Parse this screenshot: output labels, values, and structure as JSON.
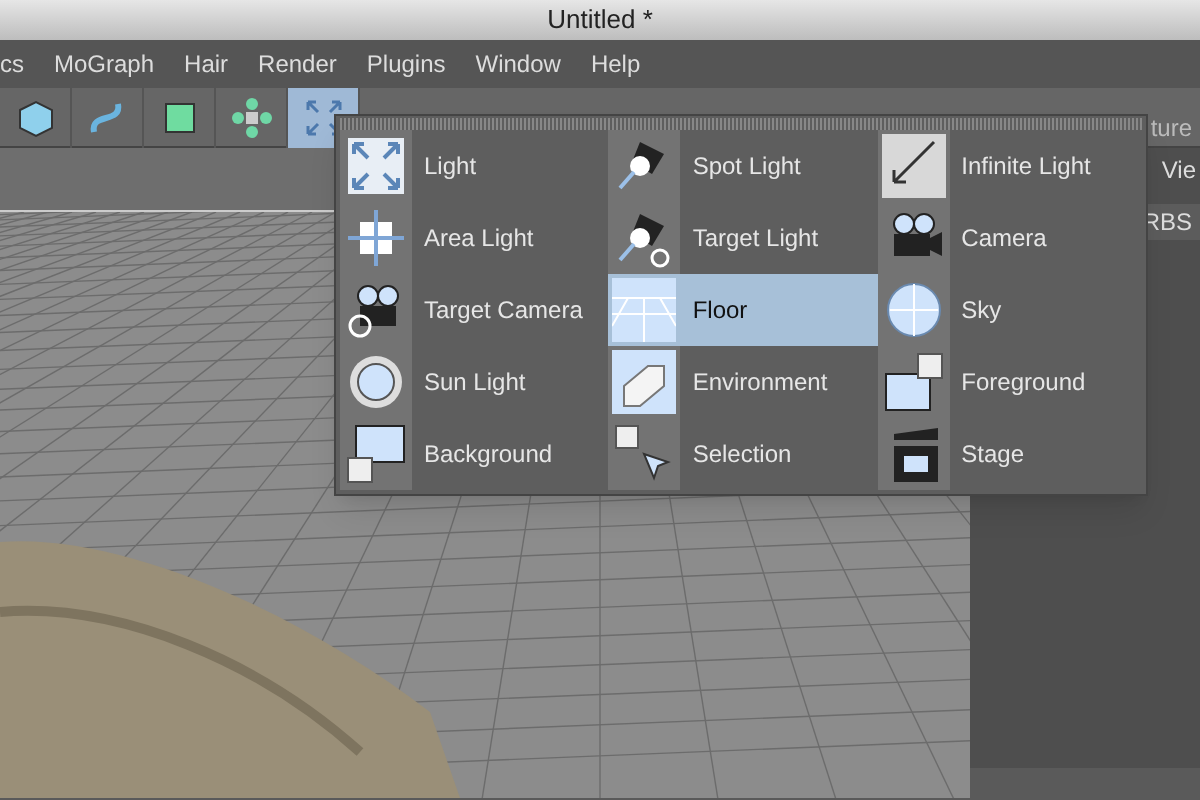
{
  "window": {
    "title": "Untitled *"
  },
  "menu": [
    "cs",
    "MoGraph",
    "Hair",
    "Render",
    "Plugins",
    "Window",
    "Help"
  ],
  "right_panel": {
    "tab_text": "ture",
    "header_text": "Vie",
    "row_text": "RBS"
  },
  "popup": {
    "columns": [
      [
        {
          "label": "Light",
          "selected": false
        },
        {
          "label": "Area Light",
          "selected": false
        },
        {
          "label": "Target Camera",
          "selected": false
        },
        {
          "label": "Sun Light",
          "selected": false
        },
        {
          "label": "Background",
          "selected": false
        }
      ],
      [
        {
          "label": "Spot Light",
          "selected": false
        },
        {
          "label": "Target Light",
          "selected": false
        },
        {
          "label": "Floor",
          "selected": true
        },
        {
          "label": "Environment",
          "selected": false
        },
        {
          "label": "Selection",
          "selected": false
        }
      ],
      [
        {
          "label": "Infinite Light",
          "selected": false
        },
        {
          "label": "Camera",
          "selected": false
        },
        {
          "label": "Sky",
          "selected": false
        },
        {
          "label": "Foreground",
          "selected": false
        },
        {
          "label": "Stage",
          "selected": false
        }
      ]
    ]
  }
}
